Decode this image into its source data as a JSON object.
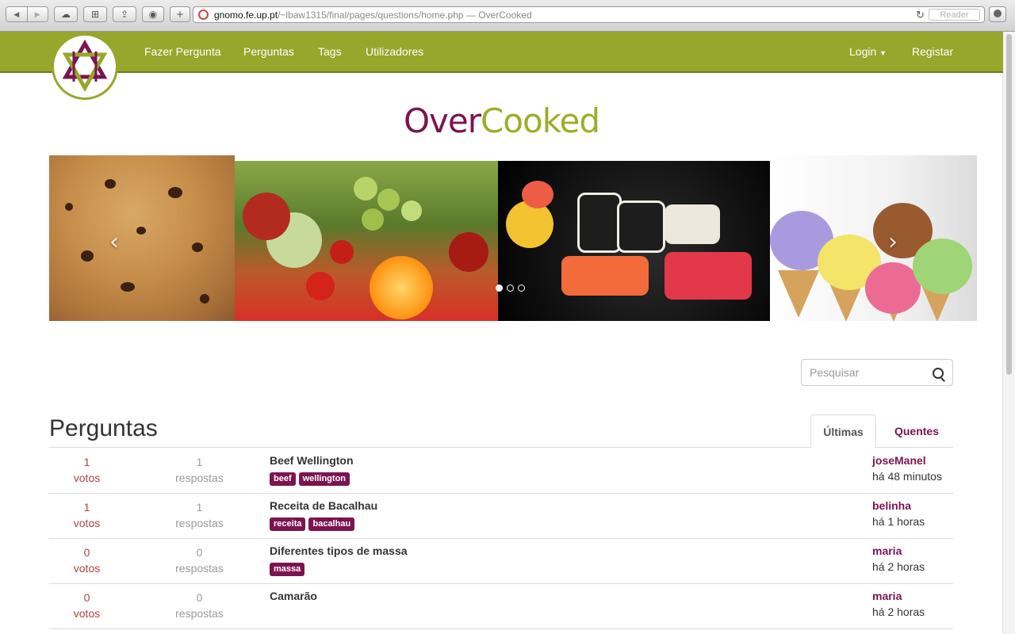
{
  "browser": {
    "url_host": "gnomo.fe.up.pt",
    "url_path": "/~lbaw1315/final/pages/questions/home.php",
    "page_title": " — OverCooked",
    "reader_label": "Reader"
  },
  "nav": {
    "left": [
      "Fazer Pergunta",
      "Perguntas",
      "Tags",
      "Utilizadores"
    ],
    "login_label": "Login",
    "register_label": "Registar"
  },
  "brand": {
    "part1": "Over",
    "part2": "Cooked"
  },
  "carousel": {
    "slides": [
      "cookies",
      "fruit",
      "sushi",
      "ice-cream"
    ],
    "active_index": 0,
    "indicator_count": 3
  },
  "search": {
    "placeholder": "Pesquisar",
    "value": ""
  },
  "questions": {
    "heading": "Perguntas",
    "tabs": [
      {
        "label": "Últimas",
        "active": true
      },
      {
        "label": "Quentes",
        "active": false
      }
    ],
    "rows": [
      {
        "votes": "1",
        "votes_label": "votos",
        "answers": "1",
        "answers_label": "respostas",
        "title": "Beef Wellington",
        "tags": [
          "beef",
          "wellington"
        ],
        "author": "joseManel",
        "time": "há 48 minutos"
      },
      {
        "votes": "1",
        "votes_label": "votos",
        "answers": "1",
        "answers_label": "respostas",
        "title": "Receita de Bacalhau",
        "tags": [
          "receita",
          "bacalhau"
        ],
        "author": "belinha",
        "time": "há 1 horas"
      },
      {
        "votes": "0",
        "votes_label": "votos",
        "answers": "0",
        "answers_label": "respostas",
        "title": "Diferentes tipos de massa",
        "tags": [
          "massa"
        ],
        "author": "maria",
        "time": "há 2 horas"
      },
      {
        "votes": "0",
        "votes_label": "votos",
        "answers": "0",
        "answers_label": "respostas",
        "title": "Camarão",
        "tags": [],
        "author": "maria",
        "time": "há 2 horas"
      }
    ]
  },
  "colors": {
    "navbar": "#96a72c",
    "accent": "#7b1450",
    "brand_green": "#9cae2a",
    "votes": "#a94442"
  }
}
